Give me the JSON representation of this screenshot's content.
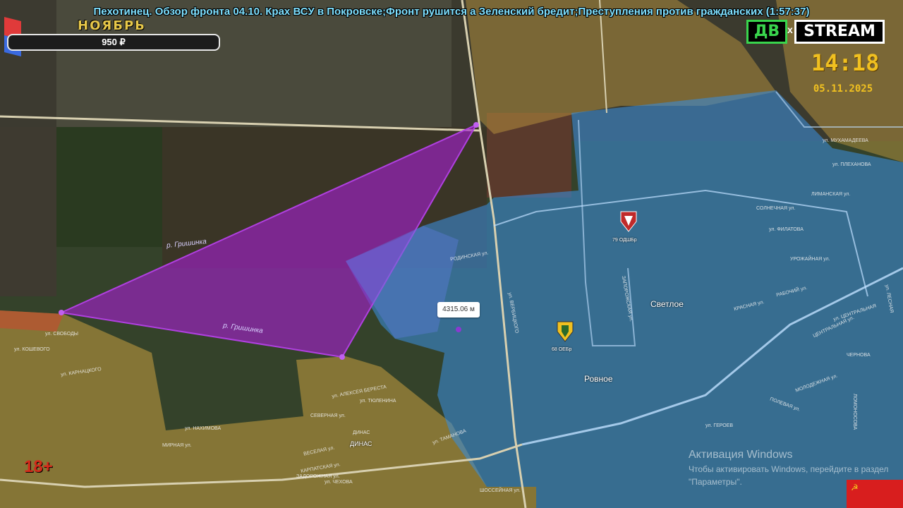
{
  "header": {
    "title": "Пехотинец. Обзор фронта 04.10. Крах ВСУ в Покровске;Фронт рушится а Зеленский бредит;Преступления против гражданских (1:57:37)",
    "month": "НОЯБРЬ",
    "donation_amount": "950 ₽",
    "donation_progress": 0.0
  },
  "logo": {
    "left": "ДВ",
    "x": "x",
    "right": "STREAM"
  },
  "clock": {
    "time": "14:18",
    "date": "05.11.2025"
  },
  "age_rating": "18+",
  "windows_activation": {
    "title": "Активация Windows",
    "line1": "Чтобы активировать Windows, перейдите в раздел",
    "line2": "\"Параметры\"."
  },
  "measurement": {
    "label": "4315.06 м"
  },
  "map": {
    "places": {
      "svetloe": "Светлое",
      "rovnoe": "Ровное",
      "dinas": "ДИНАС"
    },
    "rivers": {
      "r1": "р. Гришинка",
      "r2": "р. Гришинка"
    },
    "units": {
      "u1": "79 ОДШБр",
      "u2": "68 ОЕБр"
    },
    "streets": {
      "s1": "РОДИНСКАЯ ул.",
      "s2": "СЕВЕРНАЯ ул.",
      "s3": "ул. АЛЕКСЕЯ БЕРЕСТА",
      "s4": "ул. ТЮЛЕНИНА",
      "s5": "ул. НАХИМОВА",
      "s6": "МИРНАЯ ул.",
      "s7": "КАРПАТСКАЯ ул.",
      "s8": "ВЕСЕЛАЯ ул.",
      "s9": "ул. КОШЕВОГО",
      "s10": "ул. СВОБОДЫ",
      "s11": "СОЛНЕЧНАЯ ул.",
      "s12": "ул. ФИЛАТОВА",
      "s13": "ЛИМАНСКАЯ ул.",
      "s14": "ул. ПЛЕХАНОВА",
      "s15": "ул. ЦЕНТРАЛЬНАЯ",
      "s16": "ЗАПОРОЖСКАЯ ул.",
      "s17": "УРОЖАЙНАЯ ул.",
      "s18": "РАБОЧИЙ ул.",
      "s19": "МОЛОДЕЖНАЯ ул.",
      "s20": "ПОЛЕВАЯ ул.",
      "s21": "ШОССЕЙНАЯ ул.",
      "s22": "ЛОМОНОСОВА",
      "s23": "ул. ТАМАНОВА",
      "s24": "ул. МУХАМАДЕЕВА",
      "s25": "ул. ЧЕХОВА",
      "s26": "ДИНАС",
      "s27": "ул. КАРНАЦКОГО",
      "s28": "ЗАДОРОЖНАЯ ул.",
      "s29": "ул. ВЕРБИЦКОГО",
      "s30": "ЧЕРНОВА",
      "s31": "КРАСНАЯ ул.",
      "s32": "ул. ГЕРОЕВ",
      "s33": "ЦЕНТРАЛЬНАЯ ул.",
      "s34": "ул. ЛЕСНАЯ"
    },
    "colors": {
      "blue": "#3b8bd6",
      "purple": "#a020c8",
      "yellow": "#c8a040",
      "field": "#3a4a2a"
    }
  }
}
